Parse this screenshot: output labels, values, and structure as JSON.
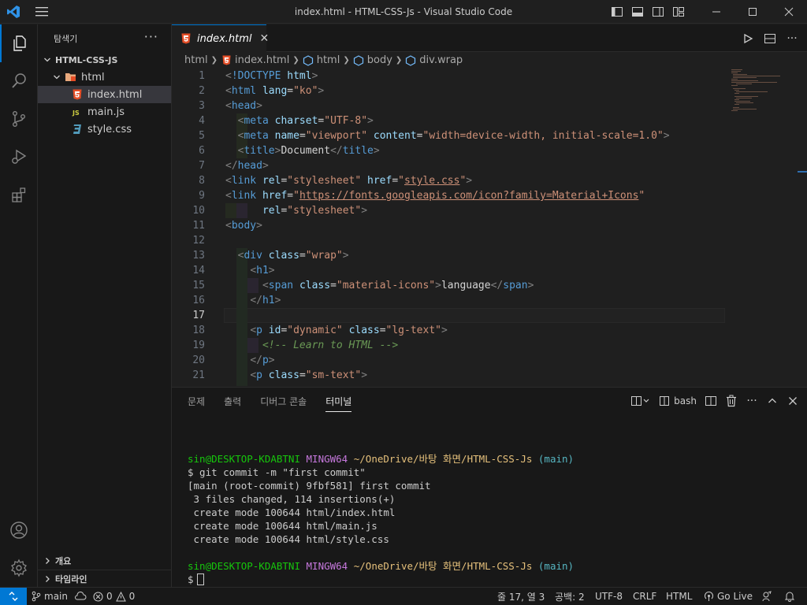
{
  "window": {
    "title": "index.html - HTML-CSS-Js - Visual Studio Code"
  },
  "sidebar": {
    "header": "탐색기",
    "project": "HTML-CSS-JS",
    "folder": "html",
    "files": [
      "index.html",
      "main.js",
      "style.css"
    ],
    "bottom": [
      "개요",
      "타임라인"
    ]
  },
  "tab": {
    "label": "index.html"
  },
  "breadcrumb": [
    "html",
    "index.html",
    "html",
    "body",
    "div.wrap"
  ],
  "editor": {
    "current_line": 17,
    "line_numbers": [
      "1",
      "2",
      "3",
      "4",
      "5",
      "6",
      "7",
      "8",
      "9",
      "10",
      "11",
      "12",
      "13",
      "14",
      "15",
      "16",
      "17",
      "18",
      "19",
      "20",
      "21"
    ]
  },
  "panel": {
    "tabs": [
      "문제",
      "출력",
      "디버그 콘솔",
      "터미널"
    ],
    "active_tab": "터미널",
    "shell": "bash",
    "terminal": {
      "prompt1": {
        "user": "sin@DESKTOP-KDABTNI",
        "env": "MINGW64",
        "path": "~/OneDrive/바탕 화면/HTML-CSS-Js",
        "branch": "(main)"
      },
      "command": "$ git commit -m \"first commit\"",
      "output": [
        "[main (root-commit) 9fbf581] first commit",
        " 3 files changed, 114 insertions(+)",
        " create mode 100644 html/index.html",
        " create mode 100644 html/main.js",
        " create mode 100644 html/style.css"
      ],
      "prompt2": {
        "user": "sin@DESKTOP-KDABTNI",
        "env": "MINGW64",
        "path": "~/OneDrive/바탕 화면/HTML-CSS-Js",
        "branch": "(main)"
      },
      "input_prompt": "$"
    }
  },
  "statusbar": {
    "branch": "main",
    "errors": "0",
    "warnings": "0",
    "position": "줄 17, 열 3",
    "spaces": "공백: 2",
    "encoding": "UTF-8",
    "eol": "CRLF",
    "language": "HTML",
    "golive": "Go Live"
  },
  "colors": {
    "accent": "#0078d4",
    "html_icon": "#e44d26",
    "js_icon": "#cbcb41",
    "css_icon": "#519aba"
  }
}
